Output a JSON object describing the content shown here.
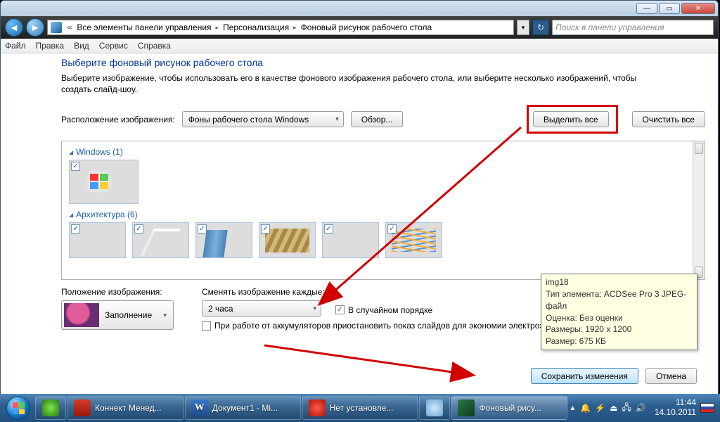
{
  "window": {
    "breadcrumb": [
      "Все элементы панели управления",
      "Персонализация",
      "Фоновый рисунок рабочего стола"
    ],
    "search_placeholder": "Поиск в панели управления"
  },
  "menu": {
    "file": "Файл",
    "edit": "Правка",
    "view": "Вид",
    "tools": "Сервис",
    "help": "Справка"
  },
  "page": {
    "title": "Выберите фоновый рисунок рабочего стола",
    "intro": "Выберите изображение, чтобы использовать его в качестве фонового изображения рабочего стола, или выберите несколько изображений, чтобы создать слайд-шоу.",
    "loc_label": "Расположение изображения:",
    "loc_value": "Фоны рабочего стола Windows",
    "browse": "Обзор...",
    "select_all": "Выделить все",
    "clear_all": "Очистить все"
  },
  "groups": {
    "g1": "Windows (1)",
    "g2": "Архитектура (6)"
  },
  "opts": {
    "position_label": "Положение изображения:",
    "position_value": "Заполнение",
    "interval_label": "Сменять изображение каждые:",
    "interval_value": "2 часа",
    "shuffle": "В случайном порядке",
    "battery": "При работе от аккумуляторов приостановить показ слайдов для экономии электроэнергии"
  },
  "footer": {
    "save": "Сохранить изменения",
    "cancel": "Отмена"
  },
  "tooltip": {
    "name": "img18",
    "type_label": "Тип элемента:",
    "type_value": "ACDSee Pro 3 JPEG-файл",
    "rating_label": "Оценка:",
    "rating_value": "Без оценки",
    "dim_label": "Размеры:",
    "dim_value": "1920 x 1200",
    "size_label": "Размер:",
    "size_value": "675 КБ"
  },
  "taskbar": {
    "t1": "Коннект Менед...",
    "t2": "Документ1 - Mi...",
    "t3": "Нет установле...",
    "t4": "Фоновый рису..."
  },
  "clock": {
    "time": "11:44",
    "date": "14.10.2011"
  }
}
